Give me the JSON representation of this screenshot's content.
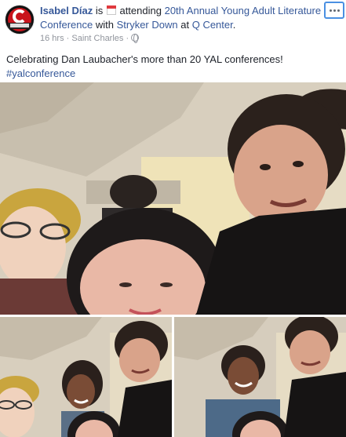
{
  "post": {
    "author": "Isabel Díaz",
    "is_text": "is",
    "activity": "attending",
    "event": "20th Annual Young Adult Literature Conference",
    "with_text": "with",
    "friend": "Stryker Down",
    "at_text": "at",
    "place": "Q Center",
    "period": ".",
    "time": "16 hrs",
    "separator": "·",
    "location": "Saint Charles",
    "separator2": "·",
    "text": "Celebrating Dan Laubacher's more than 20 YAL conferences!",
    "hashtag": "#yalconference"
  },
  "icons": {
    "calendar": "calendar-icon",
    "globe": "globe-icon",
    "more": "more-options-icon"
  },
  "colors": {
    "link": "#365899",
    "text": "#1d2129",
    "subtle": "#90949c"
  }
}
